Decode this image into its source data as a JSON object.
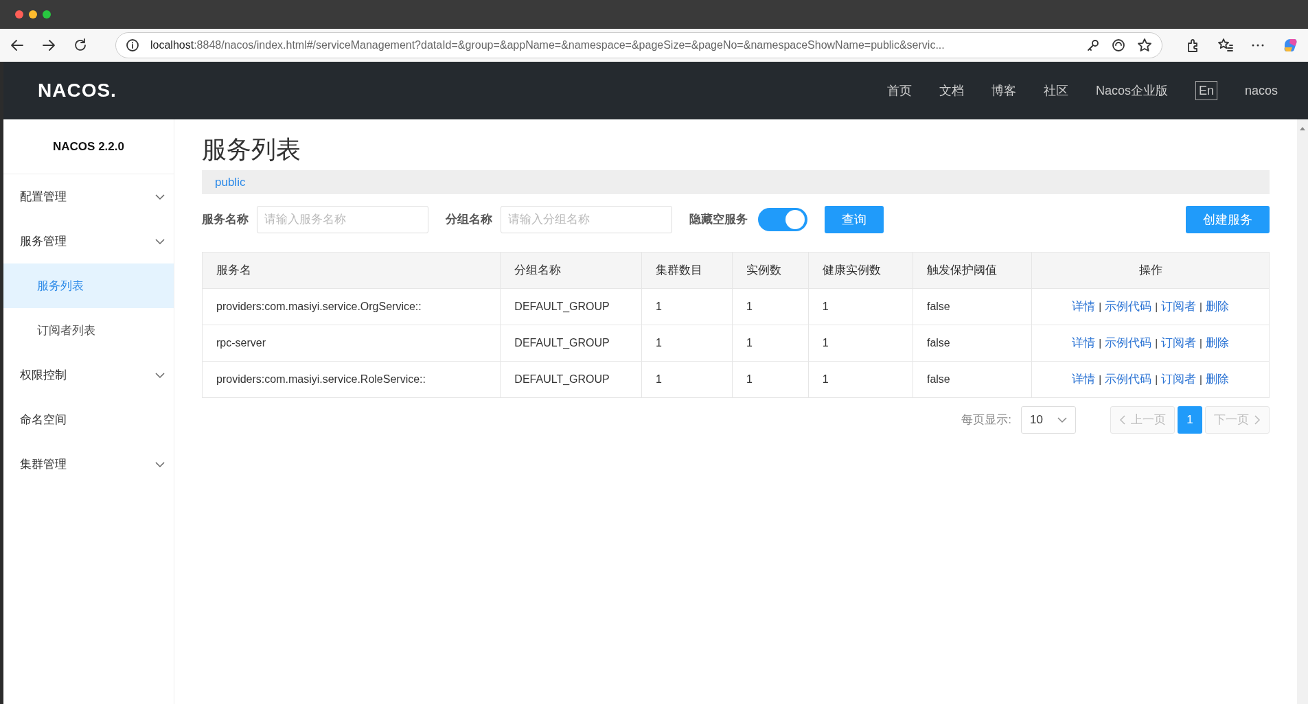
{
  "browser": {
    "url_host": "localhost",
    "url_rest": ":8848/nacos/index.html#/serviceManagement?dataId=&group=&appName=&namespace=&pageSize=&pageNo=&namespaceShowName=public&servic..."
  },
  "header": {
    "logo": "NACOS.",
    "nav": [
      {
        "label": "首页",
        "kind": "link"
      },
      {
        "label": "文档",
        "kind": "link"
      },
      {
        "label": "博客",
        "kind": "link"
      },
      {
        "label": "社区",
        "kind": "link"
      },
      {
        "label": "Nacos企业版",
        "kind": "link"
      },
      {
        "label": "En",
        "kind": "boxed"
      },
      {
        "label": "nacos",
        "kind": "link"
      }
    ]
  },
  "sidebar": {
    "title": "NACOS 2.2.0",
    "items": [
      {
        "label": "配置管理",
        "kind": "group"
      },
      {
        "label": "服务管理",
        "kind": "group",
        "children": [
          {
            "label": "服务列表",
            "selected": true
          },
          {
            "label": "订阅者列表",
            "selected": false
          }
        ]
      },
      {
        "label": "权限控制",
        "kind": "group"
      },
      {
        "label": "命名空间",
        "kind": "link"
      },
      {
        "label": "集群管理",
        "kind": "group"
      }
    ]
  },
  "page": {
    "title": "服务列表",
    "namespace": "public",
    "filters": [
      {
        "label": "服务名称",
        "placeholder": "请输入服务名称"
      },
      {
        "label": "分组名称",
        "placeholder": "请输入分组名称"
      }
    ],
    "toggle": {
      "label": "隐藏空服务",
      "on": true
    },
    "query_button": "查询",
    "create_button": "创建服务"
  },
  "table": {
    "columns": [
      "服务名",
      "分组名称",
      "集群数目",
      "实例数",
      "健康实例数",
      "触发保护阈值",
      "操作"
    ],
    "rows": [
      {
        "cells": [
          "providers:com.masiyi.service.OrgService::",
          "DEFAULT_GROUP",
          "1",
          "1",
          "1",
          "false"
        ],
        "actions": [
          "详情",
          "示例代码",
          "订阅者",
          "删除"
        ]
      },
      {
        "cells": [
          "rpc-server",
          "DEFAULT_GROUP",
          "1",
          "1",
          "1",
          "false"
        ],
        "actions": [
          "详情",
          "示例代码",
          "订阅者",
          "删除"
        ]
      },
      {
        "cells": [
          "providers:com.masiyi.service.RoleService::",
          "DEFAULT_GROUP",
          "1",
          "1",
          "1",
          "false"
        ],
        "actions": [
          "详情",
          "示例代码",
          "订阅者",
          "删除"
        ]
      }
    ],
    "separator": "|"
  },
  "pagination": {
    "label": "每页显示:",
    "page_size": "10",
    "prev": {
      "label": "上一页",
      "disabled": true
    },
    "pages": [
      {
        "label": "1",
        "selected": true
      }
    ],
    "next": {
      "label": "下一页",
      "disabled": true
    }
  }
}
